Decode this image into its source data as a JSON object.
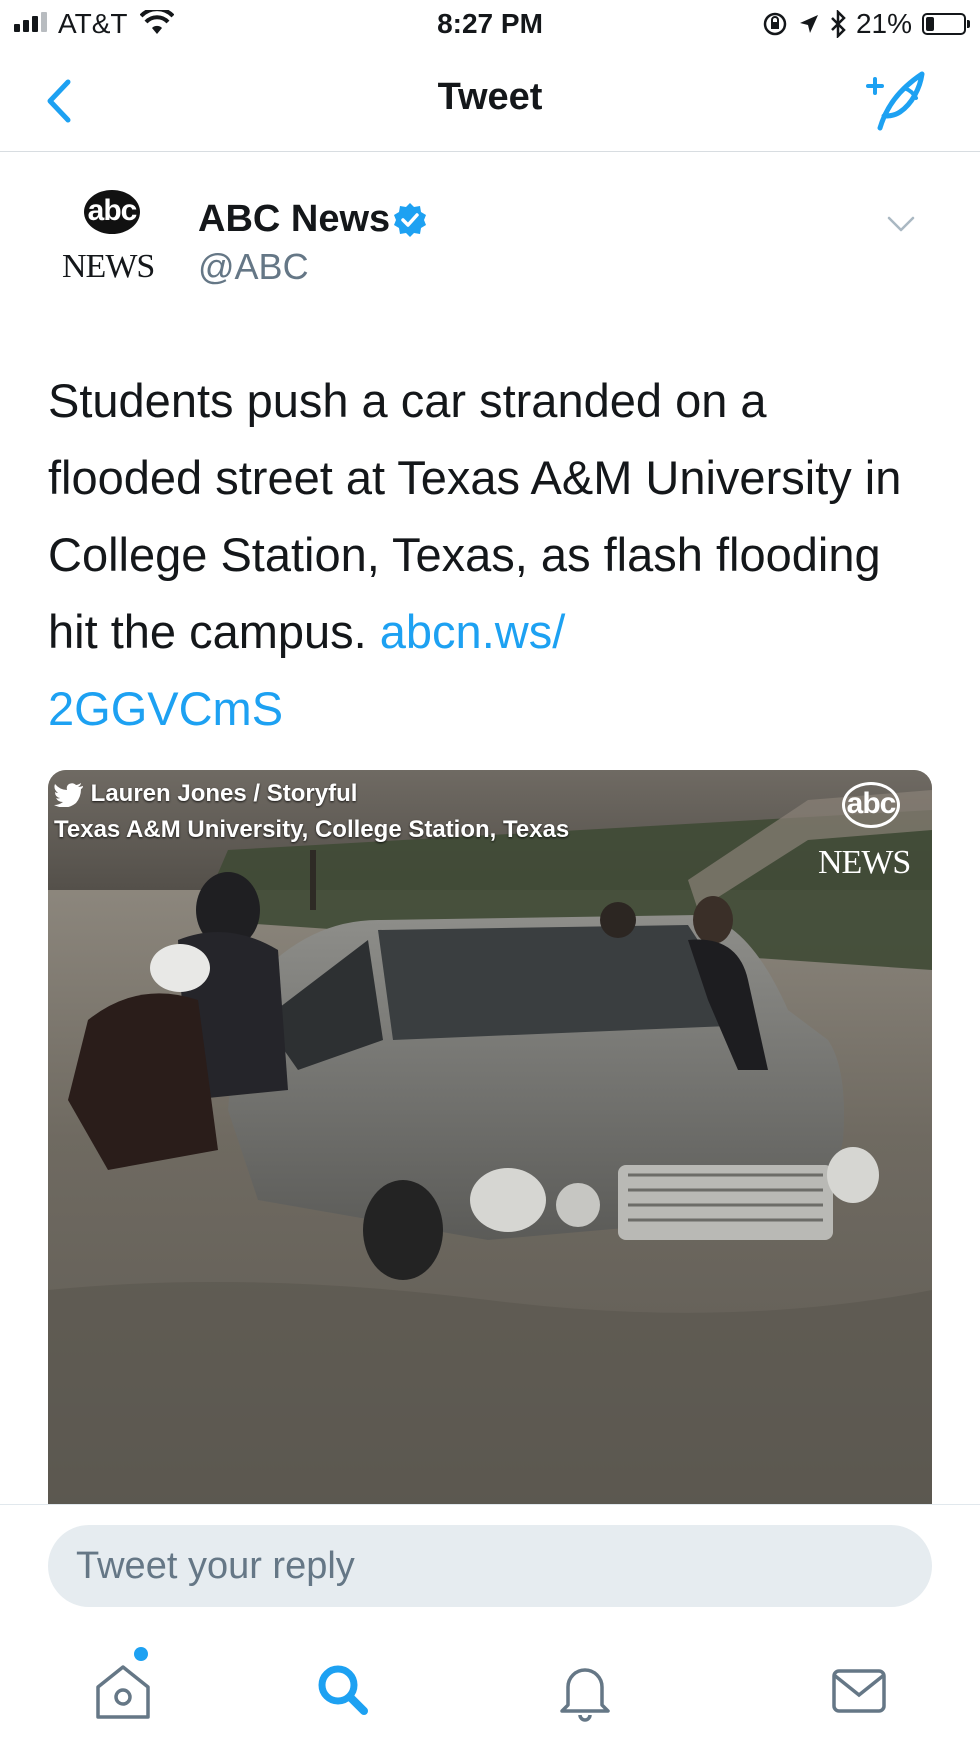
{
  "status_bar": {
    "carrier": "AT&T",
    "time": "8:27 PM",
    "battery": "21%",
    "battery_level": 0.21
  },
  "nav": {
    "title": "Tweet"
  },
  "tweet": {
    "author_name": "ABC News",
    "handle": "@ABC",
    "text": "Students push a car stranded on a flooded street at Texas A&M University in College Station, Texas, as flash flooding hit the campus. ",
    "link": "abcn.ws/\n2GGVCmS",
    "avatar_logo": {
      "top": "abc",
      "bottom": "NEWS"
    }
  },
  "media": {
    "credit_line1": "Lauren Jones / Storyful",
    "credit_line2": "Texas A&M University, College Station, Texas",
    "logo_top": "abc",
    "logo_bottom": "NEWS"
  },
  "reply": {
    "placeholder": "Tweet your reply"
  },
  "colors": {
    "accent": "#1da1f2",
    "text": "#14171a",
    "muted": "#657786"
  },
  "icons": {
    "back": "chevron-left-icon",
    "compose": "compose-quill-icon",
    "verified": "verified-badge-icon",
    "more": "chevron-down-icon",
    "home": "home-icon",
    "search": "search-icon",
    "notifications": "bell-icon",
    "messages": "envelope-icon"
  }
}
